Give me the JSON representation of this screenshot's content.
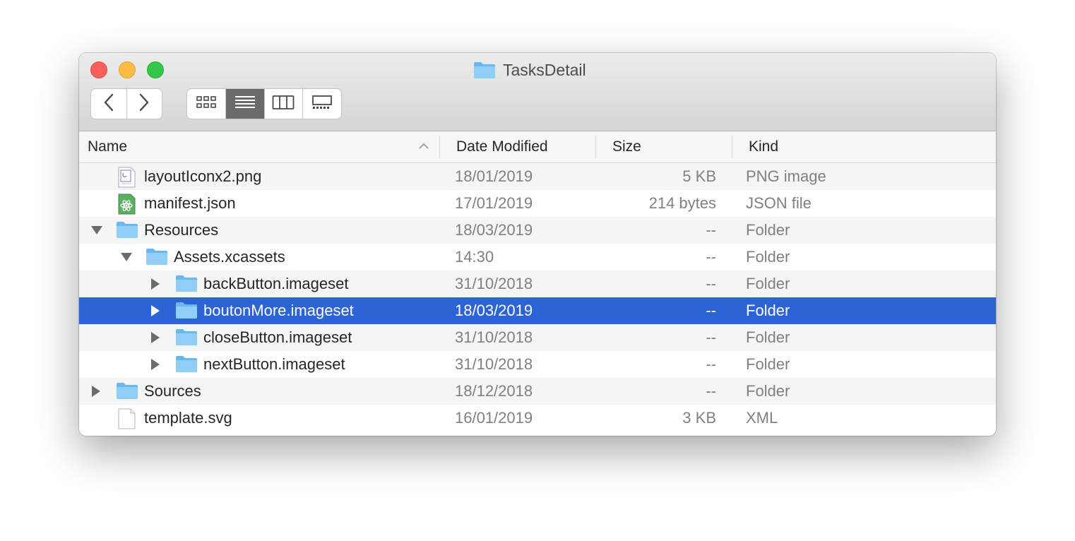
{
  "window": {
    "title": "TasksDetail",
    "title_icon": "folder-icon"
  },
  "toolbar": {
    "back_icon": "chevron-left-icon",
    "forward_icon": "chevron-right-icon",
    "views": [
      "icon-view",
      "list-view",
      "column-view",
      "gallery-view"
    ],
    "active_view": "list-view"
  },
  "columns": {
    "name": "Name",
    "date": "Date Modified",
    "size": "Size",
    "kind": "Kind",
    "sort_indicator": "sort-ascending-icon"
  },
  "rows": [
    {
      "name": "layoutIconx2.png",
      "date": "18/01/2019",
      "size": "5 KB",
      "kind": "PNG image",
      "icon": "png-file-icon",
      "depth": 0,
      "disclosure": "none"
    },
    {
      "name": "manifest.json",
      "date": "17/01/2019",
      "size": "214 bytes",
      "kind": "JSON file",
      "icon": "json-file-icon",
      "depth": 0,
      "disclosure": "none"
    },
    {
      "name": "Resources",
      "date": "18/03/2019",
      "size": "--",
      "kind": "Folder",
      "icon": "folder-icon",
      "depth": 0,
      "disclosure": "expanded"
    },
    {
      "name": "Assets.xcassets",
      "date": "14:30",
      "size": "--",
      "kind": "Folder",
      "icon": "folder-icon",
      "depth": 1,
      "disclosure": "expanded"
    },
    {
      "name": "backButton.imageset",
      "date": "31/10/2018",
      "size": "--",
      "kind": "Folder",
      "icon": "folder-icon",
      "depth": 2,
      "disclosure": "collapsed"
    },
    {
      "name": "boutonMore.imageset",
      "date": "18/03/2019",
      "size": "--",
      "kind": "Folder",
      "icon": "folder-icon",
      "depth": 2,
      "disclosure": "collapsed",
      "selected": true
    },
    {
      "name": "closeButton.imageset",
      "date": "31/10/2018",
      "size": "--",
      "kind": "Folder",
      "icon": "folder-icon",
      "depth": 2,
      "disclosure": "collapsed"
    },
    {
      "name": "nextButton.imageset",
      "date": "31/10/2018",
      "size": "--",
      "kind": "Folder",
      "icon": "folder-icon",
      "depth": 2,
      "disclosure": "collapsed"
    },
    {
      "name": "Sources",
      "date": "18/12/2018",
      "size": "--",
      "kind": "Folder",
      "icon": "folder-icon",
      "depth": 0,
      "disclosure": "collapsed"
    },
    {
      "name": "template.svg",
      "date": "16/01/2019",
      "size": "3 KB",
      "kind": "XML",
      "icon": "generic-file-icon",
      "depth": 0,
      "disclosure": "none"
    }
  ],
  "colors": {
    "selection": "#2c64d5",
    "folder": "#7fc4f3",
    "close": "#fc605c",
    "minimize": "#fdbc40",
    "maximize": "#34c84a"
  }
}
